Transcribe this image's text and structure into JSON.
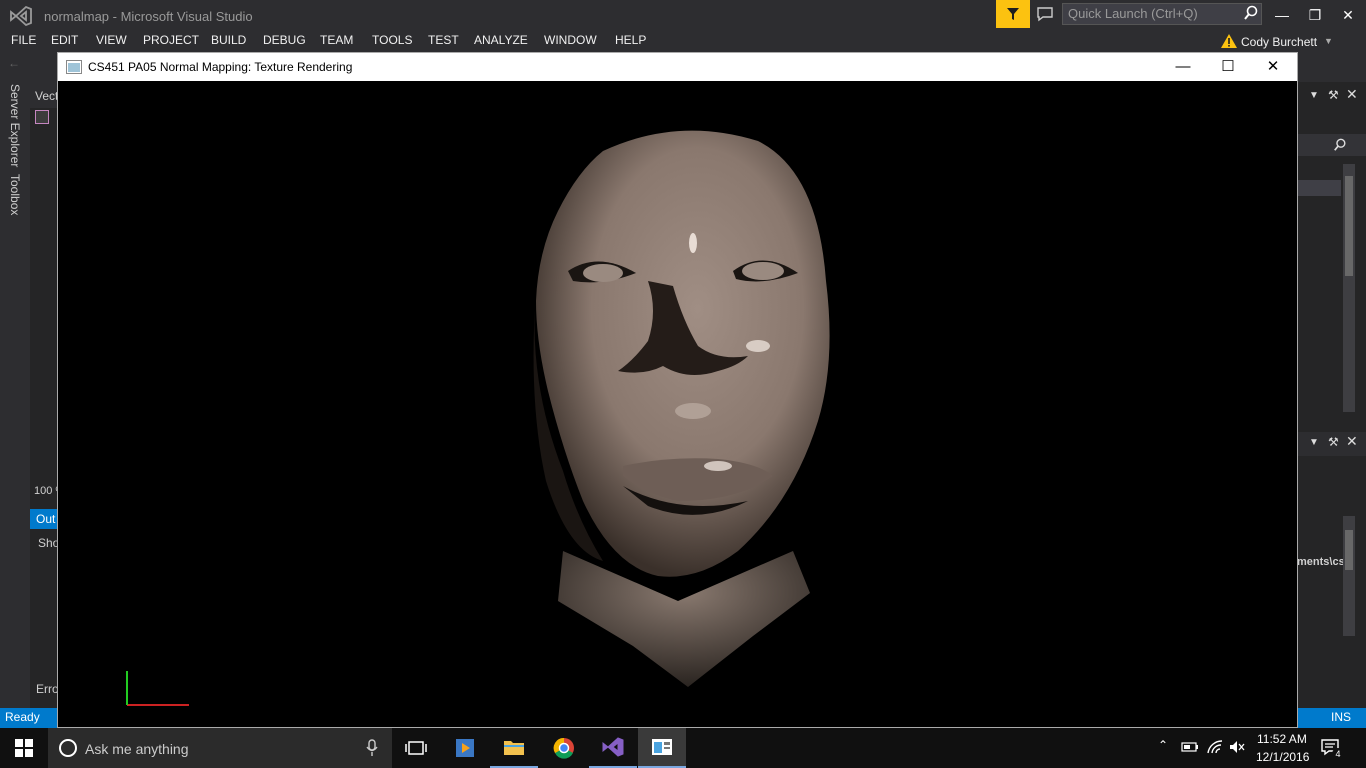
{
  "vs": {
    "window_title": "normalmap - Microsoft Visual Studio",
    "quick_launch_placeholder": "Quick Launch (Ctrl+Q)",
    "user_name": "Cody Burchett",
    "menu": [
      "FILE",
      "EDIT",
      "VIEW",
      "PROJECT",
      "BUILD",
      "DEBUG",
      "TEAM",
      "TOOLS",
      "TEST",
      "ANALYZE",
      "WINDOW",
      "HELP"
    ],
    "side_tabs": [
      "Server Explorer",
      "Toolbox"
    ],
    "left_panel": {
      "tab_label": "Vect",
      "zoom": "100 %",
      "output_tab": "Out",
      "show_label": "Sho",
      "error_tab": "Erro"
    },
    "right_panel": {
      "path_fragment": "ments\\cs"
    },
    "status": {
      "left": "Ready",
      "right": "INS"
    }
  },
  "gl_window": {
    "title": "CS451 PA05 Normal Mapping: Texture Rendering"
  },
  "taskbar": {
    "search_placeholder": "Ask me anything",
    "time": "11:52 AM",
    "date": "12/1/2016",
    "notification_count": "4"
  },
  "colors": {
    "vs_dark": "#2d2d30",
    "accent_blue": "#007acc",
    "filter_yellow": "#fcc210",
    "axis_red": "#cc2222",
    "axis_green": "#22cc22"
  }
}
